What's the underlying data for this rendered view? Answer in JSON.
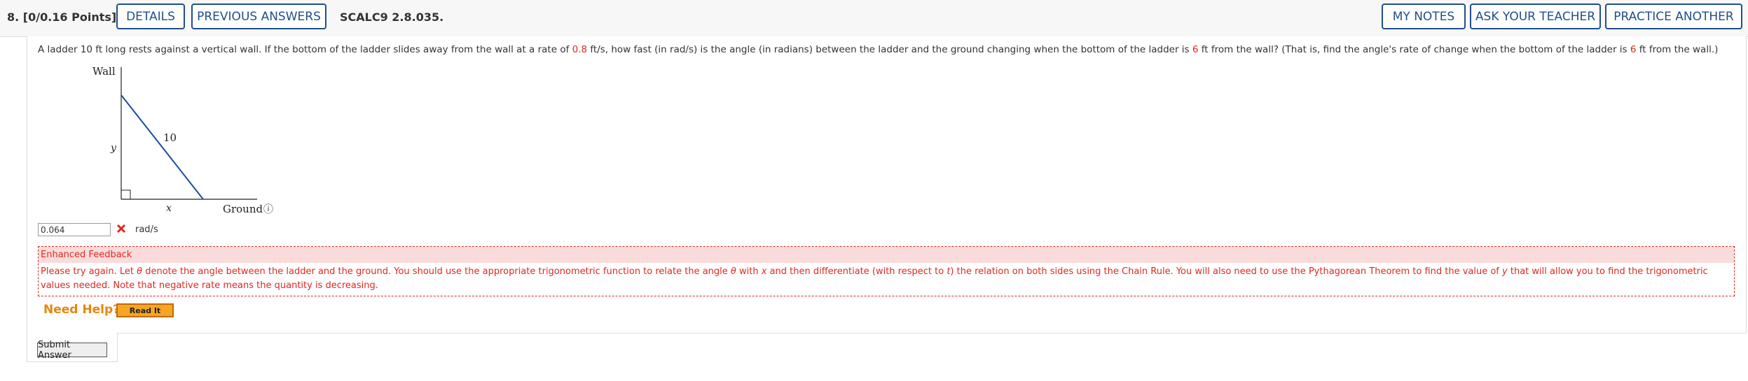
{
  "header": {
    "question_number": "8.",
    "points": "[0/0.16 Points]",
    "details_label": "DETAILS",
    "previous_answers_label": "PREVIOUS ANSWERS",
    "question_id": "SCALC9 2.8.035.",
    "my_notes_label": "MY NOTES",
    "ask_teacher_label": "ASK YOUR TEACHER",
    "practice_label": "PRACTICE ANOTHER"
  },
  "question": {
    "part1": "A ladder 10 ft long rests against a vertical wall. If the bottom of the ladder slides away from the wall at a rate of ",
    "rate": "0.8",
    "part2": " ft/s, how fast (in rad/s) is the angle (in radians) between the ladder and the ground changing when the bottom of the ladder is ",
    "distance1": "6",
    "part3": " ft from the wall? (That is, find the angle's rate of change when the bottom of the ladder is ",
    "distance2": "6",
    "part4": " ft from the wall.)"
  },
  "figure": {
    "wall_label": "Wall",
    "ladder_label": "10",
    "y_label": "y",
    "x_label": "x",
    "ground_label": "Ground",
    "info_glyph": "ⓘ"
  },
  "answer": {
    "value": "0.064",
    "unit": "rad/s",
    "status": "incorrect"
  },
  "feedback": {
    "title": "Enhanced Feedback",
    "text_parts": [
      "Please try again. Let ",
      "θ",
      " denote the angle between the ladder and the ground. You should use the appropriate trigonometric function to relate the angle ",
      "θ",
      " with ",
      "x",
      " and then differentiate (with respect to ",
      "t",
      ") the relation on both sides using the Chain Rule. You will also need to use the Pythagorean Theorem to find the value of ",
      "y",
      " that will allow you to find the trigonometric values needed. Note that negative rate means the quantity is decreasing."
    ]
  },
  "help": {
    "label": "Need Help?",
    "read_it_label": "Read It"
  },
  "submit_label": "Submit Answer",
  "colors": {
    "accent_blue": "#1f4e8c",
    "error_red": "#e0281f",
    "help_orange": "#e8860c"
  }
}
